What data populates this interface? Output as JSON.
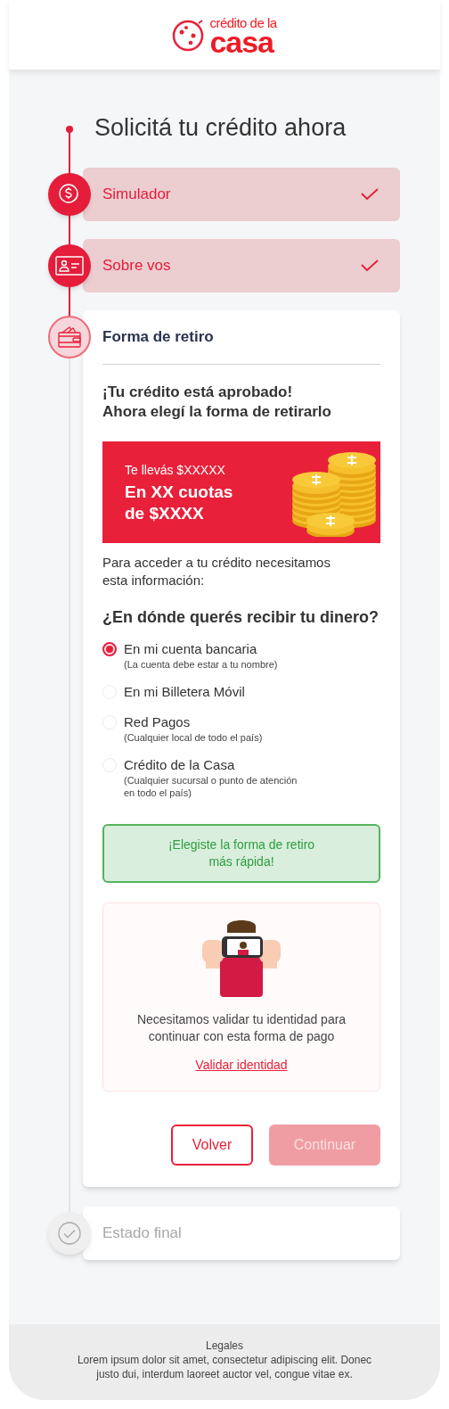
{
  "header": {
    "logo_top": "crédito de la",
    "logo_bottom": "casa"
  },
  "title": "Solicitá tu crédito ahora",
  "steps": [
    {
      "label": "Simulador",
      "kind": "dollar",
      "done": true,
      "selected": false
    },
    {
      "label": "Sobre vos",
      "kind": "idcard",
      "done": true,
      "selected": false
    },
    {
      "label": "Forma de retiro",
      "kind": "wallet",
      "done": false,
      "selected": true
    },
    {
      "label": "Estado final",
      "kind": "check",
      "done": false,
      "selected": false
    }
  ],
  "withdrawal": {
    "heading_lines": [
      "¡Tu crédito está aprobado!",
      "Ahora elegí la forma de retirarlo"
    ],
    "banner": {
      "amount": "Te llevás $XXXXX",
      "installments_lines": [
        "En XX cuotas",
        "de $XXXX"
      ]
    },
    "intro": "Para acceder a tu crédito necesitamos esta información:",
    "question": "¿En dónde querés recibir tu dinero?",
    "options": [
      {
        "label": "En mi cuenta bancaria",
        "note_lines": [
          "(La cuenta debe estar a tu nombre)"
        ],
        "selected": true
      },
      {
        "label": "En mi Billetera Móvil",
        "selected": false
      },
      {
        "label": "Red Pagos",
        "note_lines": [
          "(Cualquier local de todo el país)"
        ],
        "selected": false
      },
      {
        "label": "Crédito de la Casa",
        "note_lines": [
          "(Cualquier sucursal o punto de atención",
          "en todo el país)"
        ],
        "selected": false
      }
    ],
    "success_lines": [
      "¡Elegiste la forma de retiro",
      "más rápida!"
    ],
    "identity": {
      "text_lines": [
        "Necesitamos validar tu identidad para",
        "continuar con esta forma de pago"
      ],
      "link": "Validar identidad"
    },
    "buttons": {
      "back": "Volver",
      "next": "Continuar",
      "next_disabled": true
    }
  },
  "footer": {
    "title": "Legales",
    "text_lines": [
      "Lorem ipsum dolor sit amet, consectetur adipiscing elit. Donec",
      "justo dui, interdum laoreet auctor vel, congue vitae ex."
    ]
  }
}
